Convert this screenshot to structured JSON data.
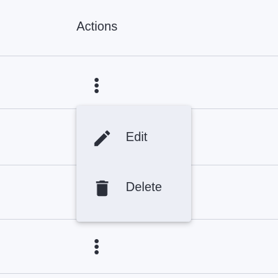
{
  "table": {
    "header": {
      "actions_label": "Actions"
    },
    "rows": [
      {
        "actions_icon": "more-vertical-icon"
      },
      {
        "actions_icon": null
      },
      {
        "actions_icon": null
      },
      {
        "actions_icon": "more-vertical-icon"
      }
    ]
  },
  "menu": {
    "items": [
      {
        "label": "Edit",
        "icon": "pencil-icon"
      },
      {
        "label": "Delete",
        "icon": "trash-icon"
      }
    ]
  },
  "colors": {
    "background": "#f7f8fc",
    "divider": "#d3d6df",
    "text": "#2b2f3a",
    "menu_background": "#eceef5"
  }
}
